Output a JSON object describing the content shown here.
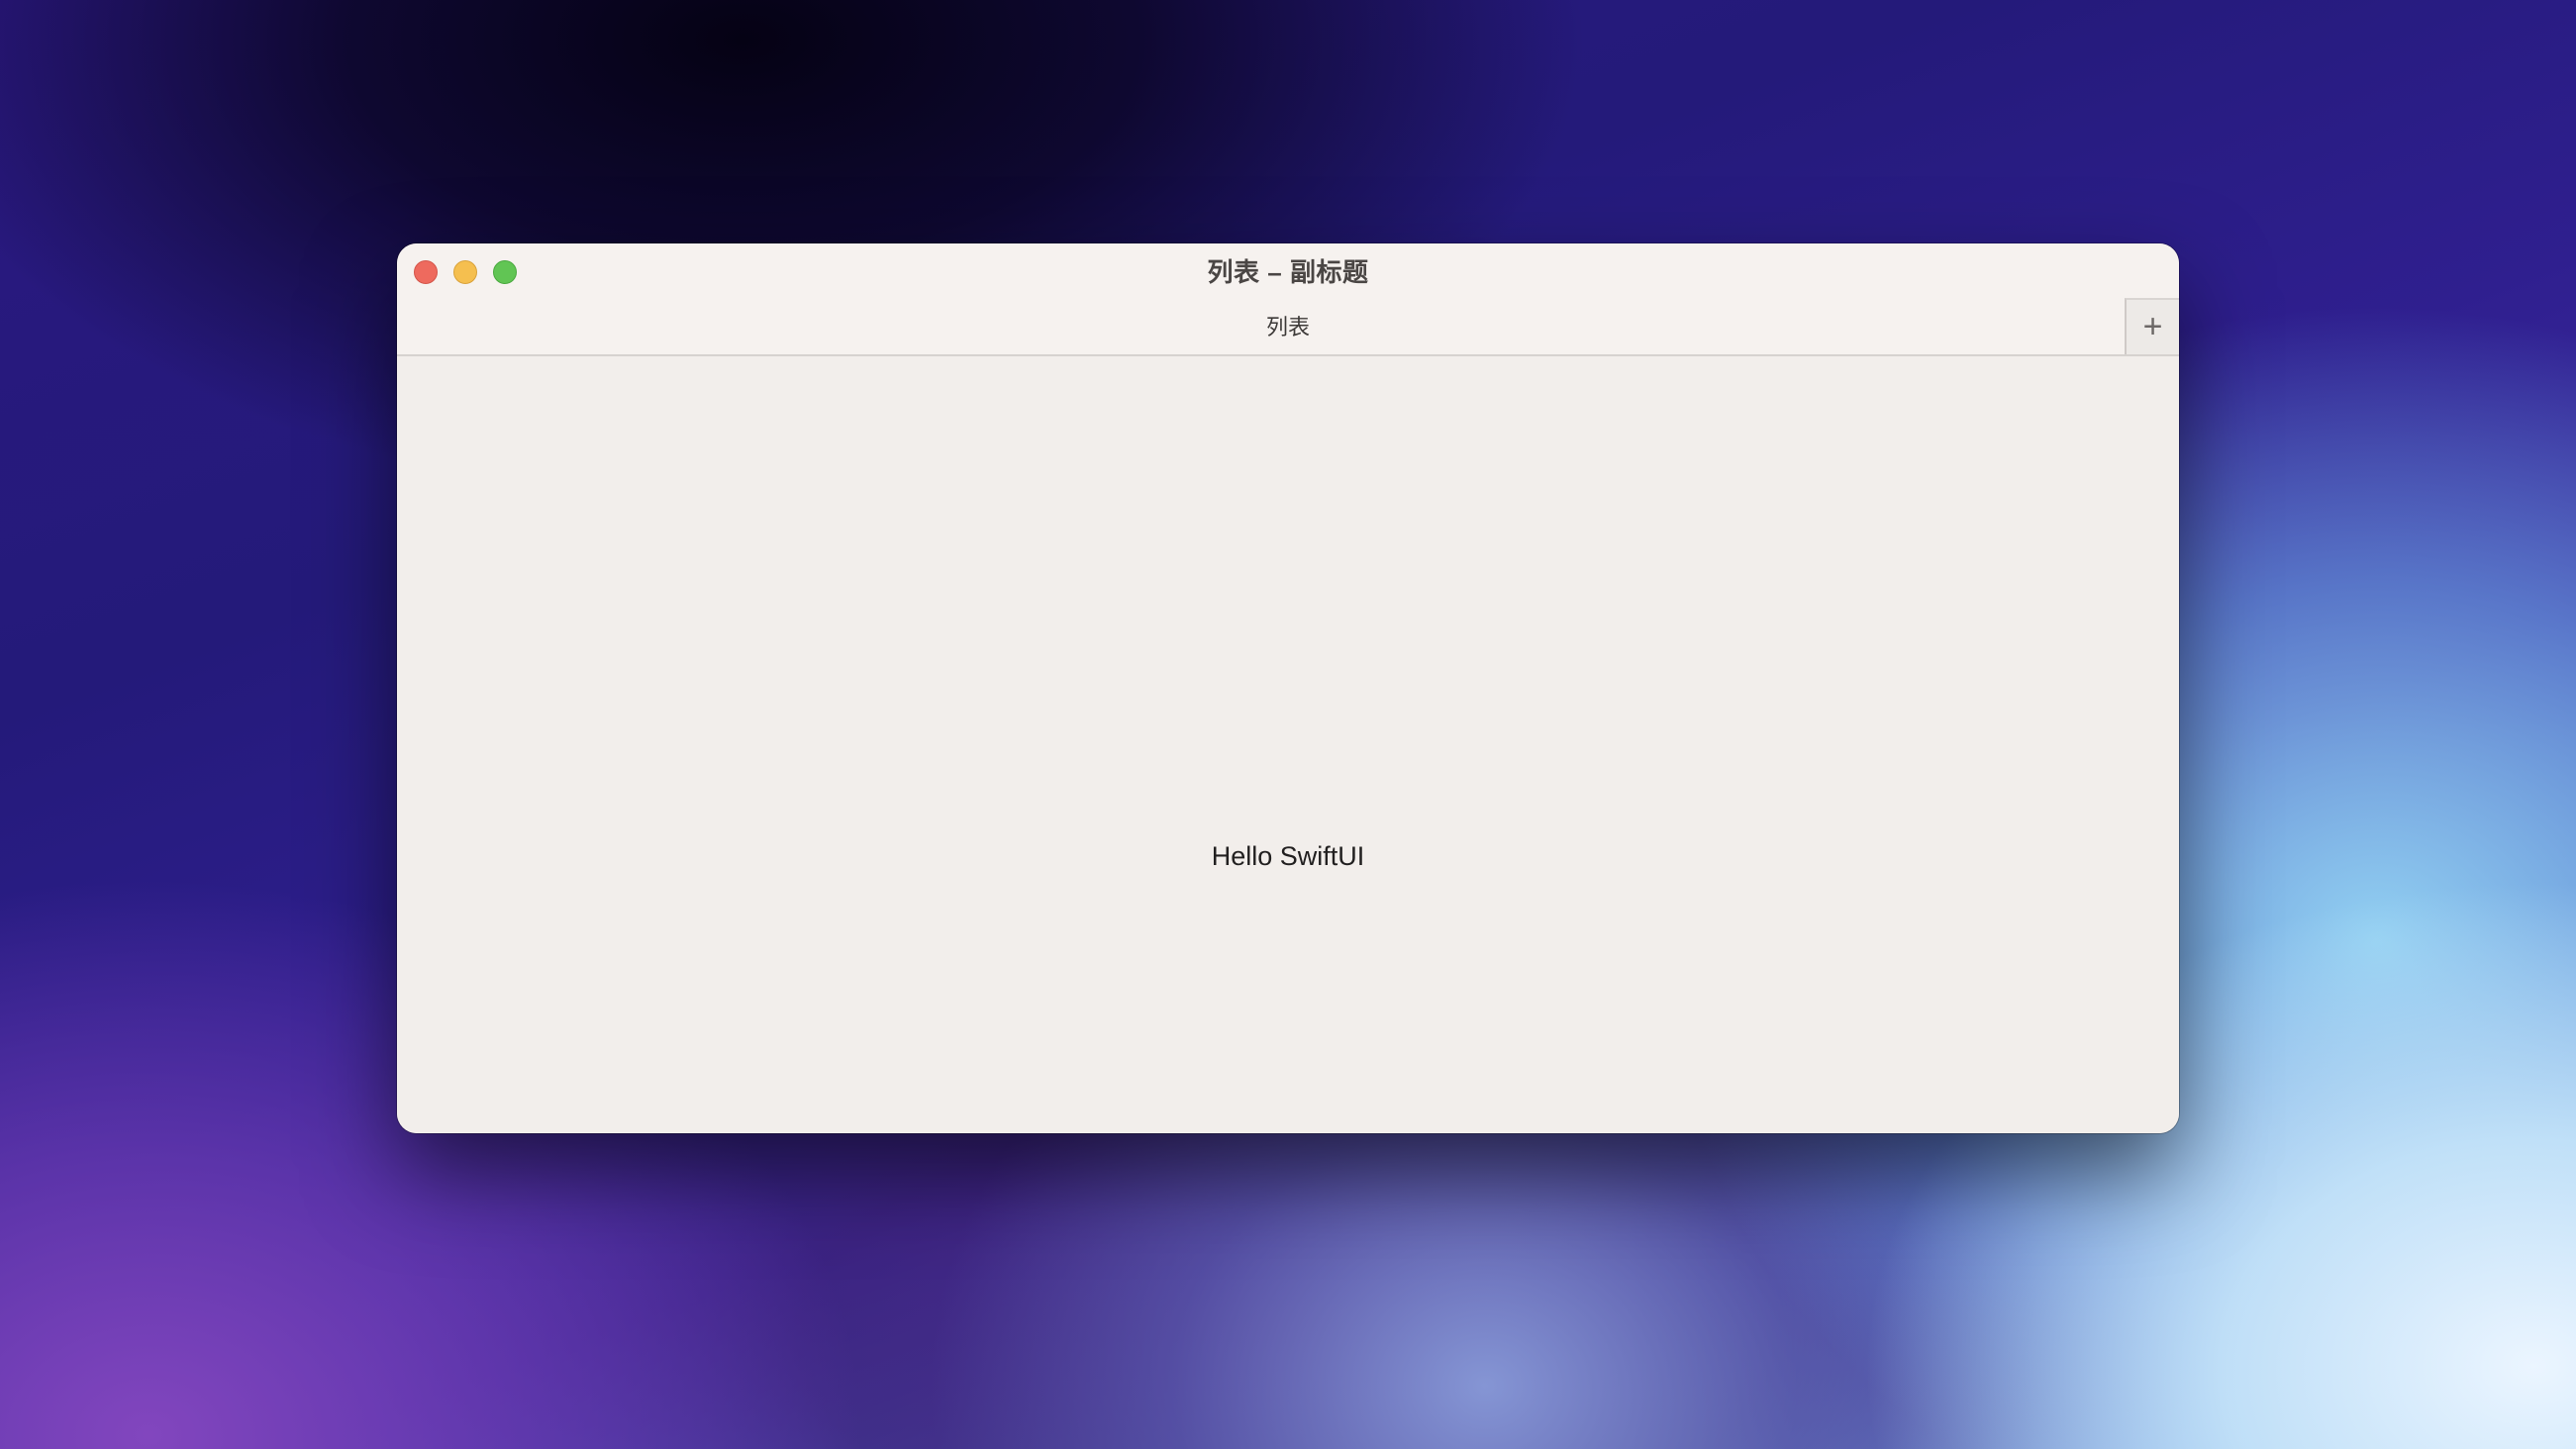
{
  "window": {
    "title": "列表 – 副标题"
  },
  "tab_bar": {
    "tabs": [
      {
        "label": "列表"
      }
    ],
    "add_tab_label": "+"
  },
  "content": {
    "text": "Hello SwiftUI"
  },
  "colors": {
    "close": "#ee6a5e",
    "minimize": "#f5bf4f",
    "zoom": "#61c554",
    "window_background": "#f2eeeb"
  }
}
